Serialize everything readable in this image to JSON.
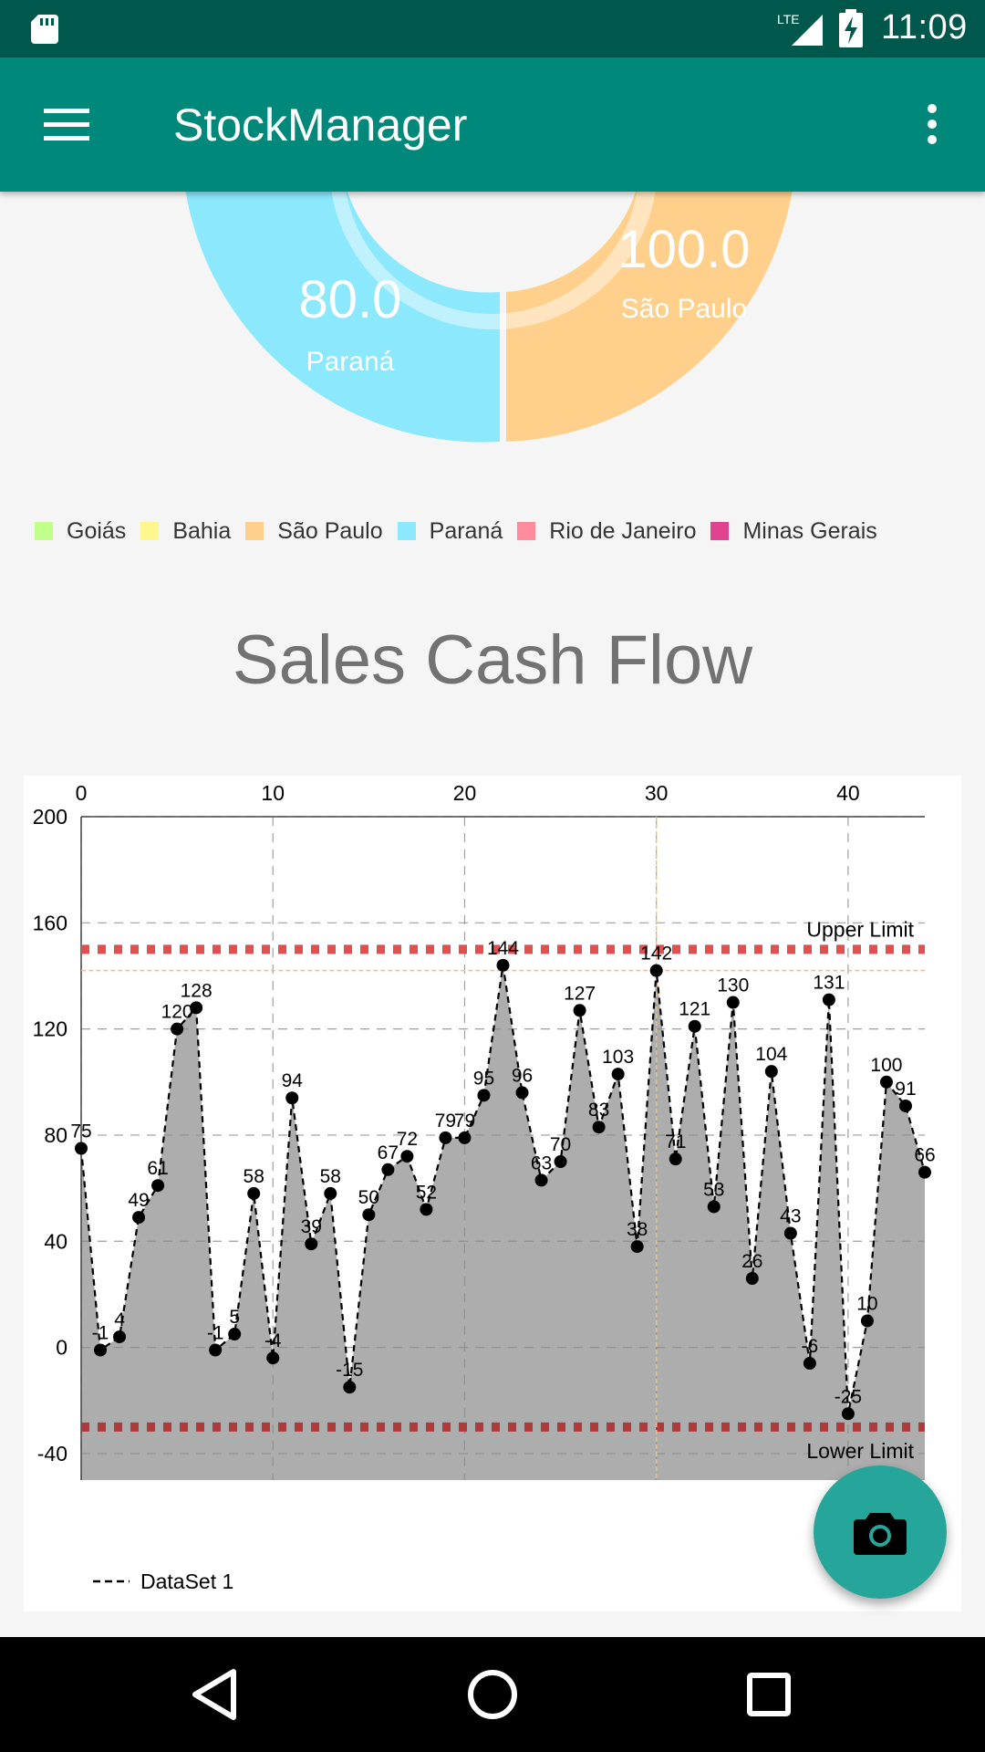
{
  "status_bar": {
    "time": "11:09",
    "network": "LTE"
  },
  "app_bar": {
    "title": "StockManager"
  },
  "pie": {
    "slices": [
      {
        "label": "São Paulo",
        "value": "100.0",
        "color": "#ffd08b"
      },
      {
        "label": "Paraná",
        "value": "80.0",
        "color": "#8ce8fc"
      }
    ],
    "legend": [
      {
        "label": "Goiás",
        "color": "#c1ff8a"
      },
      {
        "label": "Bahia",
        "color": "#fff68e"
      },
      {
        "label": "São Paulo",
        "color": "#ffd08b"
      },
      {
        "label": "Paraná",
        "color": "#8ce8fc"
      },
      {
        "label": "Rio de Janeiro",
        "color": "#ff8c9d"
      },
      {
        "label": "Minas Gerais",
        "color": "#e0438f"
      }
    ]
  },
  "chart_title": "Sales Cash Flow",
  "chart_data": {
    "type": "area",
    "x_ticks": [
      "0",
      "10",
      "20",
      "30",
      "40"
    ],
    "y_ticks": [
      "200",
      "160",
      "120",
      "80",
      "40",
      "0",
      "-40"
    ],
    "xlim": [
      0,
      44
    ],
    "ylim": [
      -50,
      200
    ],
    "x": [
      0,
      1,
      2,
      3,
      4,
      5,
      6,
      7,
      8,
      9,
      10,
      11,
      12,
      13,
      14,
      15,
      16,
      17,
      18,
      19,
      20,
      21,
      22,
      23,
      24,
      25,
      26,
      27,
      28,
      29,
      30,
      31,
      32,
      33,
      34,
      35,
      36,
      37,
      38,
      39,
      40,
      41,
      42,
      43,
      44
    ],
    "series": [
      {
        "name": "DataSet 1",
        "values": [
          75,
          -1,
          4,
          49,
          61,
          120,
          128,
          -1,
          5,
          58,
          -4,
          94,
          39,
          58,
          -15,
          50,
          67,
          72,
          52,
          79,
          79,
          95,
          144,
          96,
          63,
          70,
          127,
          83,
          103,
          38,
          142,
          71,
          121,
          53,
          130,
          26,
          104,
          43,
          -6,
          131,
          -25,
          10,
          100,
          91,
          66
        ],
        "line_color": "#000000",
        "fill_color": "#adadad",
        "line_style": "dashed"
      }
    ],
    "limit_lines": [
      {
        "label": "Upper Limit",
        "value": 150,
        "color": "#e05050"
      },
      {
        "label": "Lower Limit",
        "value": -30,
        "color": "#b03a3a"
      }
    ],
    "highlight": {
      "x": 30,
      "y": 142,
      "color": "#ffbb73"
    },
    "grid": true
  },
  "fab": {
    "icon": "camera-icon"
  },
  "nav": {
    "back_icon": "back-icon",
    "home_icon": "home-icon",
    "recents_icon": "recents-icon"
  }
}
